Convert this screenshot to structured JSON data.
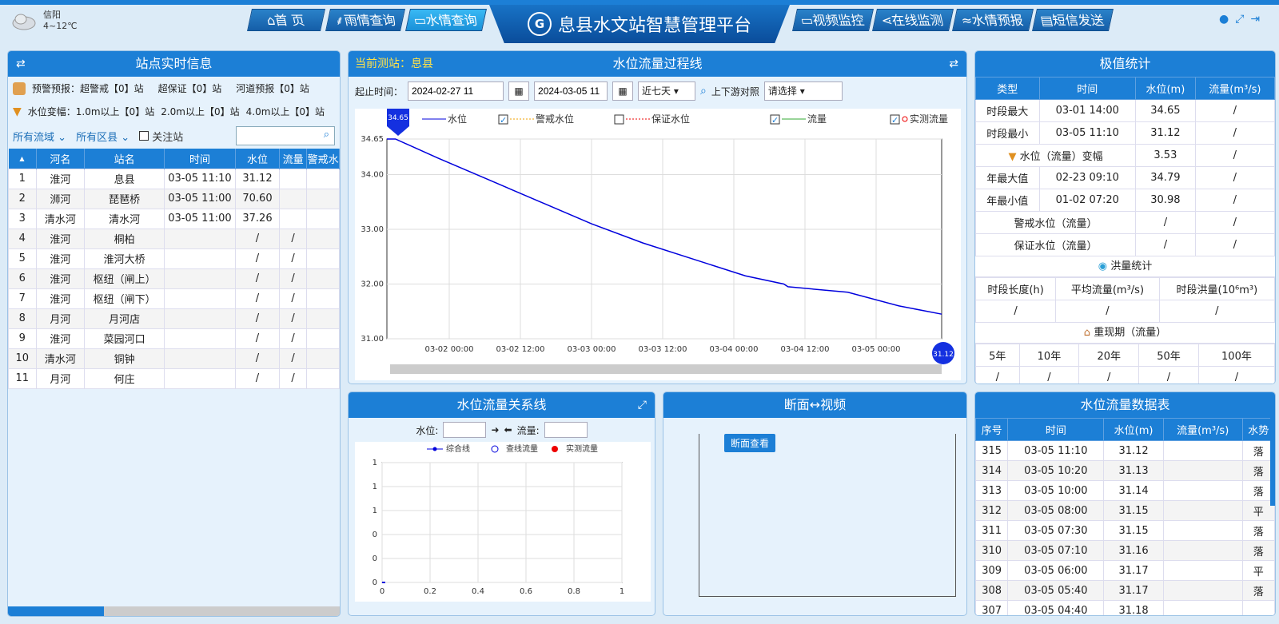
{
  "weather": {
    "city": "信阳",
    "temp": "4~12℃"
  },
  "nav": {
    "home": "首 页",
    "rain": "雨情查询",
    "water": "水情查询",
    "title": "息县水文站智慧管理平台",
    "video": "视频监控",
    "online": "在线监测",
    "forecast": "水情预报",
    "sms": "短信发送"
  },
  "left": {
    "title": "站点实时信息",
    "warn1": "预警预报：超警戒【0】站",
    "warn2": "超保证【0】站",
    "warn3": "河道预报【0】站",
    "change1": "水位变幅：1.0m以上【0】站",
    "change2": "2.0m以上【0】站",
    "change3": "4.0m以上【0】站",
    "f_basin": "所有流域",
    "f_area": "所有区县",
    "f_focus": "关注站",
    "headers": [
      "",
      "河名",
      "站名",
      "时间",
      "水位",
      "流量",
      "警戒水"
    ],
    "rows": [
      [
        "1",
        "淮河",
        "息县",
        "03-05 11:10",
        "31.12",
        "",
        ""
      ],
      [
        "2",
        "浉河",
        "琵琶桥",
        "03-05 11:00",
        "70.60",
        "",
        ""
      ],
      [
        "3",
        "清水河",
        "清水河",
        "03-05 11:00",
        "37.26",
        "",
        ""
      ],
      [
        "4",
        "淮河",
        "桐柏",
        "",
        "/",
        "/",
        ""
      ],
      [
        "5",
        "淮河",
        "淮河大桥",
        "",
        "/",
        "/",
        ""
      ],
      [
        "6",
        "淮河",
        "枢纽（闸上）",
        "",
        "/",
        "/",
        ""
      ],
      [
        "7",
        "淮河",
        "枢纽（闸下）",
        "",
        "/",
        "/",
        ""
      ],
      [
        "8",
        "月河",
        "月河店",
        "",
        "/",
        "/",
        ""
      ],
      [
        "9",
        "淮河",
        "菜园河口",
        "",
        "/",
        "/",
        ""
      ],
      [
        "10",
        "清水河",
        "铜钟",
        "",
        "/",
        "/",
        ""
      ],
      [
        "11",
        "月河",
        "何庄",
        "",
        "/",
        "/",
        ""
      ]
    ]
  },
  "process": {
    "current": "当前测站：息县",
    "title": "水位流量过程线",
    "label_range": "起止时间：",
    "start": "2024-02-27 11",
    "end": "2024-03-05 11",
    "period": "近七天",
    "compare": "上下游对照",
    "compare_select": "请选择"
  },
  "chart_data": {
    "type": "line",
    "legend": [
      "水位",
      "警戒水位",
      "保证水位",
      "流量",
      "实测流量"
    ],
    "x_ticks": [
      "03-02 00:00",
      "03-02 12:00",
      "03-03 00:00",
      "03-03 12:00",
      "03-04 00:00",
      "03-04 12:00",
      "03-05 00:00"
    ],
    "y_ticks": [
      "31.00",
      "32.00",
      "33.00",
      "34.00",
      "34.65"
    ],
    "ylim": [
      31.0,
      34.65
    ],
    "series": [
      {
        "name": "水位",
        "x_hours": [
          0,
          2,
          12,
          24,
          36,
          48,
          60,
          72,
          84,
          93,
          94,
          108,
          120,
          130
        ],
        "values": [
          34.65,
          34.65,
          34.3,
          33.9,
          33.5,
          33.1,
          32.75,
          32.45,
          32.15,
          32.0,
          31.95,
          31.85,
          31.6,
          31.45
        ]
      }
    ],
    "max_marker": "34.65",
    "min_marker": "31.12",
    "grid": true,
    "legend_position": "top"
  },
  "relation": {
    "title": "水位流量关系线",
    "label_level": "水位:",
    "label_flow": "流量:",
    "legend": [
      "综合线",
      "查线流量",
      "实测流量"
    ],
    "x_ticks": [
      "0",
      "0.2",
      "0.4",
      "0.6",
      "0.8",
      "1"
    ],
    "y_ticks": [
      "0",
      "0",
      "0",
      "1",
      "1",
      "1"
    ]
  },
  "section": {
    "title": "断面↔视频",
    "button": "断面查看"
  },
  "extreme": {
    "title": "极值统计",
    "headers": [
      "类型",
      "时间",
      "水位(m)",
      "流量(m³/s)"
    ],
    "rows": [
      [
        "时段最大",
        "03-01 14:00",
        "34.65",
        "/"
      ],
      [
        "时段最小",
        "03-05 11:10",
        "31.12",
        "/"
      ],
      [
        "水位（流量）变幅",
        "",
        "3.53",
        "/"
      ],
      [
        "年最大值",
        "02-23 09:10",
        "34.79",
        "/"
      ],
      [
        "年最小值",
        "01-02 07:20",
        "30.98",
        "/"
      ],
      [
        "警戒水位（流量）",
        "",
        "/",
        "/"
      ],
      [
        "保证水位（流量）",
        "",
        "/",
        "/"
      ]
    ],
    "flood_title": "洪量统计",
    "flood_headers": [
      "时段长度(h)",
      "平均流量(m³/s)",
      "时段洪量(10⁶m³)"
    ],
    "flood_values": [
      "/",
      "/",
      "/"
    ],
    "return_title": "重现期（流量）",
    "return_headers": [
      "5年",
      "10年",
      "20年",
      "50年",
      "100年"
    ],
    "return_values": [
      "/",
      "/",
      "/",
      "/",
      "/"
    ]
  },
  "datatable": {
    "title": "水位流量数据表",
    "headers": [
      "序号",
      "时间",
      "水位(m)",
      "流量(m³/s)",
      "水势"
    ],
    "rows": [
      [
        "315",
        "03-05 11:10",
        "31.12",
        "",
        "落"
      ],
      [
        "314",
        "03-05 10:20",
        "31.13",
        "",
        "落"
      ],
      [
        "313",
        "03-05 10:00",
        "31.14",
        "",
        "落"
      ],
      [
        "312",
        "03-05 08:00",
        "31.15",
        "",
        "平"
      ],
      [
        "311",
        "03-05 07:30",
        "31.15",
        "",
        "落"
      ],
      [
        "310",
        "03-05 07:10",
        "31.16",
        "",
        "落"
      ],
      [
        "309",
        "03-05 06:00",
        "31.17",
        "",
        "平"
      ],
      [
        "308",
        "03-05 05:40",
        "31.17",
        "",
        "落"
      ],
      [
        "307",
        "03-05 04:40",
        "31.18",
        "",
        ""
      ]
    ]
  }
}
